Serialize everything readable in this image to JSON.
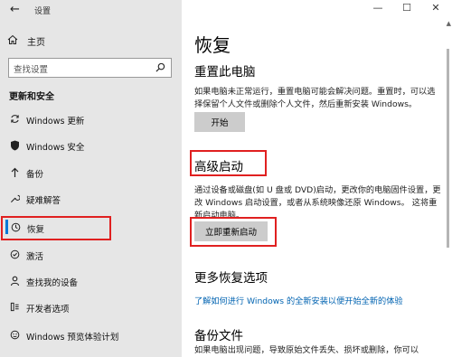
{
  "window": {
    "title": "设置",
    "minimize_glyph": "—",
    "maximize_glyph": "☐",
    "close_glyph": "✕"
  },
  "sidebar": {
    "home_label": "主页",
    "search_placeholder": "查找设置",
    "section_title": "更新和安全",
    "items": [
      {
        "label": "Windows 更新",
        "icon": "sync-icon"
      },
      {
        "label": "Windows 安全",
        "icon": "shield-icon"
      },
      {
        "label": "备份",
        "icon": "backup-arrow-icon"
      },
      {
        "label": "疑难解答",
        "icon": "wrench-icon"
      },
      {
        "label": "恢复",
        "icon": "history-icon"
      },
      {
        "label": "激活",
        "icon": "activation-check-icon"
      },
      {
        "label": "查找我的设备",
        "icon": "person-locate-icon"
      },
      {
        "label": "开发者选项",
        "icon": "developer-tools-icon"
      },
      {
        "label": "Windows 预览体验计划",
        "icon": "insider-face-icon"
      }
    ],
    "active_index": 4
  },
  "main": {
    "page_title": "恢复",
    "reset": {
      "heading": "重置此电脑",
      "description": "如果电脑未正常运行，重置电脑可能会解决问题。重置时，可以选择保留个人文件或删除个人文件，然后重新安装 Windows。",
      "button": "开始"
    },
    "advanced": {
      "heading": "高级启动",
      "description": "通过设备或磁盘(如 U 盘或 DVD)启动，更改你的电脑固件设置，更改 Windows 启动设置，或者从系统映像还原 Windows。 这将重新启动电脑。",
      "button": "立即重新启动"
    },
    "more": {
      "heading": "更多恢复选项",
      "link": "了解如何进行 Windows 的全新安装以便开始全新的体验"
    },
    "backup": {
      "heading": "备份文件",
      "description": "如果电脑出现问题，导致原始文件丢失、损坏或删除，你可以"
    }
  },
  "colors": {
    "sidebar_bg": "#e6e6e6",
    "accent": "#0078d7",
    "link": "#0063b1",
    "highlight_box": "#e02020",
    "button_bg": "#cccccc"
  }
}
